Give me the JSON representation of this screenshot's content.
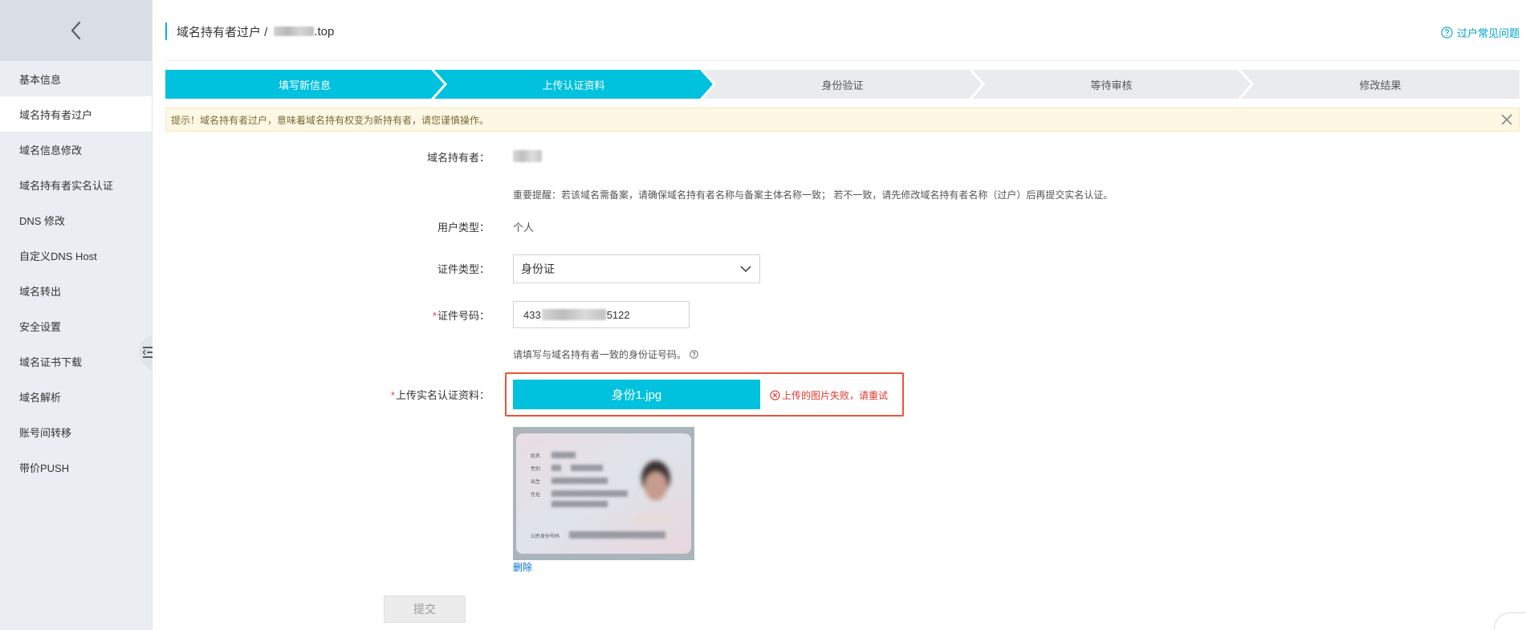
{
  "sidebar": {
    "back_icon": "chevron-left-icon",
    "items": [
      {
        "label": "基本信息",
        "active": false
      },
      {
        "label": "域名持有者过户",
        "active": true
      },
      {
        "label": "域名信息修改",
        "active": false
      },
      {
        "label": "域名持有者实名认证",
        "active": false
      },
      {
        "label": "DNS 修改",
        "active": false
      },
      {
        "label": "自定义DNS Host",
        "active": false
      },
      {
        "label": "域名转出",
        "active": false
      },
      {
        "label": "安全设置",
        "active": false
      },
      {
        "label": "域名证书下载",
        "active": false
      },
      {
        "label": "域名解析",
        "active": false
      },
      {
        "label": "账号间转移",
        "active": false
      },
      {
        "label": "带价PUSH",
        "active": false
      }
    ]
  },
  "header": {
    "breadcrumb_title": "域名持有者过户 /",
    "domain_suffix": ".top",
    "faq_label": "过户常见问题"
  },
  "steps": [
    {
      "label": "填写新信息",
      "state": "done"
    },
    {
      "label": "上传认证资料",
      "state": "current"
    },
    {
      "label": "身份验证",
      "state": "pending"
    },
    {
      "label": "等待审核",
      "state": "pending"
    },
    {
      "label": "修改结果",
      "state": "pending"
    }
  ],
  "notice": {
    "text": "提示！域名持有者过户，意味着域名持有权变为新持有者，请您谨慎操作。"
  },
  "form": {
    "holder_label": "域名持有者：",
    "reminder": "重要提醒：若该域名需备案，请确保域名持有者名称与备案主体名称一致； 若不一致，请先修改域名持有者名称（过户）后再提交实名认证。",
    "user_type_label": "用户类型：",
    "user_type_value": "个人",
    "cert_type_label": "证件类型：",
    "cert_type_value": "身份证",
    "cert_number_label": "证件号码：",
    "cert_number_prefix": "433",
    "cert_number_suffix": "5122",
    "cert_hint": "请填写与域名持有者一致的身份证号码。",
    "upload_label": "上传实名认证资料：",
    "upload_file": "身份1.jpg",
    "upload_error": "上传的图片失败，请重试",
    "delete_label": "删除",
    "submit_label": "提交",
    "id_card": {
      "name_label": "姓名",
      "gender_label": "性别",
      "birth_label": "出生",
      "address_label": "住址",
      "id_label": "公民身份号码"
    }
  },
  "colors": {
    "accent": "#00c1de",
    "error": "#e6372b",
    "link": "#0070cc"
  }
}
